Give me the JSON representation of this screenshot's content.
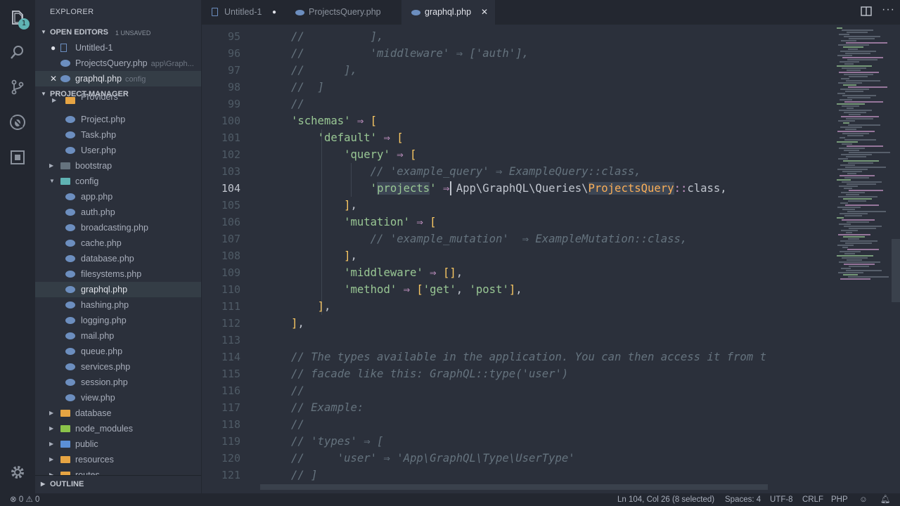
{
  "sidebar": {
    "title": "EXPLORER",
    "open_editors": {
      "label": "OPEN EDITORS",
      "count": "1 UNSAVED"
    },
    "open_files": [
      {
        "name": "Untitled-1",
        "sub": ""
      },
      {
        "name": "ProjectsQuery.php",
        "sub": "app\\Graph..."
      },
      {
        "name": "graphql.php",
        "sub": "config"
      }
    ],
    "project": "PROJECT-MANAGER",
    "tree": [
      "Providers",
      "Project.php",
      "Task.php",
      "User.php",
      "bootstrap",
      "config",
      "app.php",
      "auth.php",
      "broadcasting.php",
      "cache.php",
      "database.php",
      "filesystems.php",
      "graphql.php",
      "hashing.php",
      "logging.php",
      "mail.php",
      "queue.php",
      "services.php",
      "session.php",
      "view.php",
      "database",
      "node_modules",
      "public",
      "resources",
      "routes"
    ],
    "outline": "OUTLINE"
  },
  "tabs": [
    {
      "label": "Untitled-1"
    },
    {
      "label": "ProjectsQuery.php"
    },
    {
      "label": "graphql.php"
    }
  ],
  "editor": {
    "line_numbers": [
      "95",
      "96",
      "97",
      "98",
      "99",
      "100",
      "101",
      "102",
      "103",
      "104",
      "105",
      "106",
      "107",
      "108",
      "109",
      "110",
      "111",
      "112",
      "113",
      "114",
      "115",
      "116",
      "117",
      "118",
      "119",
      "120",
      "121"
    ],
    "current_line": "104"
  },
  "status": {
    "errors": "0",
    "warnings": "0",
    "position": "Ln 104, Col 26 (8 selected)",
    "spaces": "Spaces: 4",
    "encoding": "UTF-8",
    "eol": "CRLF",
    "language": "PHP"
  }
}
